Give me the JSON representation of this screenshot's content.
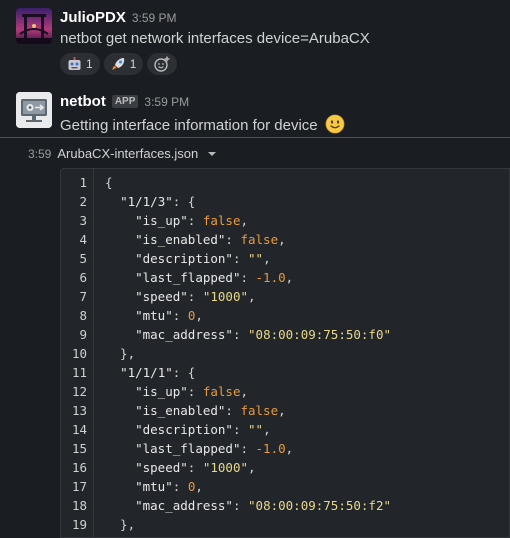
{
  "message1": {
    "author": "JulioPDX",
    "time": "3:59 PM",
    "text": "netbot get network interfaces device=ArubaCX",
    "reactions": [
      {
        "emoji": "robot-face",
        "count": "1"
      },
      {
        "emoji": "rocket",
        "count": "1"
      }
    ]
  },
  "message2": {
    "author": "netbot",
    "badge": "APP",
    "time": "3:59 PM",
    "text": "Getting interface information for device",
    "emoji": "slightly-smiling-face"
  },
  "file": {
    "time": "3:59",
    "name": "ArubaCX-interfaces.json"
  },
  "code_lines": [
    {
      "n": "1",
      "parts": [
        {
          "t": "{",
          "c": "p"
        }
      ]
    },
    {
      "n": "2",
      "parts": [
        {
          "t": "  ",
          "c": "p"
        },
        {
          "t": "\"1/1/3\"",
          "c": "k"
        },
        {
          "t": ": {",
          "c": "p"
        }
      ]
    },
    {
      "n": "3",
      "parts": [
        {
          "t": "    ",
          "c": "p"
        },
        {
          "t": "\"is_up\"",
          "c": "k"
        },
        {
          "t": ": ",
          "c": "p"
        },
        {
          "t": "false",
          "c": "b"
        },
        {
          "t": ",",
          "c": "p"
        }
      ]
    },
    {
      "n": "4",
      "parts": [
        {
          "t": "    ",
          "c": "p"
        },
        {
          "t": "\"is_enabled\"",
          "c": "k"
        },
        {
          "t": ": ",
          "c": "p"
        },
        {
          "t": "false",
          "c": "b"
        },
        {
          "t": ",",
          "c": "p"
        }
      ]
    },
    {
      "n": "5",
      "parts": [
        {
          "t": "    ",
          "c": "p"
        },
        {
          "t": "\"description\"",
          "c": "k"
        },
        {
          "t": ": ",
          "c": "p"
        },
        {
          "t": "\"\"",
          "c": "s"
        },
        {
          "t": ",",
          "c": "p"
        }
      ]
    },
    {
      "n": "6",
      "parts": [
        {
          "t": "    ",
          "c": "p"
        },
        {
          "t": "\"last_flapped\"",
          "c": "k"
        },
        {
          "t": ": ",
          "c": "p"
        },
        {
          "t": "-1.0",
          "c": "n"
        },
        {
          "t": ",",
          "c": "p"
        }
      ]
    },
    {
      "n": "7",
      "parts": [
        {
          "t": "    ",
          "c": "p"
        },
        {
          "t": "\"speed\"",
          "c": "k"
        },
        {
          "t": ": ",
          "c": "p"
        },
        {
          "t": "\"1000\"",
          "c": "s"
        },
        {
          "t": ",",
          "c": "p"
        }
      ]
    },
    {
      "n": "8",
      "parts": [
        {
          "t": "    ",
          "c": "p"
        },
        {
          "t": "\"mtu\"",
          "c": "k"
        },
        {
          "t": ": ",
          "c": "p"
        },
        {
          "t": "0",
          "c": "n"
        },
        {
          "t": ",",
          "c": "p"
        }
      ]
    },
    {
      "n": "9",
      "parts": [
        {
          "t": "    ",
          "c": "p"
        },
        {
          "t": "\"mac_address\"",
          "c": "k"
        },
        {
          "t": ": ",
          "c": "p"
        },
        {
          "t": "\"08:00:09:75:50:f0\"",
          "c": "s"
        }
      ]
    },
    {
      "n": "10",
      "parts": [
        {
          "t": "  },",
          "c": "p"
        }
      ]
    },
    {
      "n": "11",
      "parts": [
        {
          "t": "  ",
          "c": "p"
        },
        {
          "t": "\"1/1/1\"",
          "c": "k"
        },
        {
          "t": ": {",
          "c": "p"
        }
      ]
    },
    {
      "n": "12",
      "parts": [
        {
          "t": "    ",
          "c": "p"
        },
        {
          "t": "\"is_up\"",
          "c": "k"
        },
        {
          "t": ": ",
          "c": "p"
        },
        {
          "t": "false",
          "c": "b"
        },
        {
          "t": ",",
          "c": "p"
        }
      ]
    },
    {
      "n": "13",
      "parts": [
        {
          "t": "    ",
          "c": "p"
        },
        {
          "t": "\"is_enabled\"",
          "c": "k"
        },
        {
          "t": ": ",
          "c": "p"
        },
        {
          "t": "false",
          "c": "b"
        },
        {
          "t": ",",
          "c": "p"
        }
      ]
    },
    {
      "n": "14",
      "parts": [
        {
          "t": "    ",
          "c": "p"
        },
        {
          "t": "\"description\"",
          "c": "k"
        },
        {
          "t": ": ",
          "c": "p"
        },
        {
          "t": "\"\"",
          "c": "s"
        },
        {
          "t": ",",
          "c": "p"
        }
      ]
    },
    {
      "n": "15",
      "parts": [
        {
          "t": "    ",
          "c": "p"
        },
        {
          "t": "\"last_flapped\"",
          "c": "k"
        },
        {
          "t": ": ",
          "c": "p"
        },
        {
          "t": "-1.0",
          "c": "n"
        },
        {
          "t": ",",
          "c": "p"
        }
      ]
    },
    {
      "n": "16",
      "parts": [
        {
          "t": "    ",
          "c": "p"
        },
        {
          "t": "\"speed\"",
          "c": "k"
        },
        {
          "t": ": ",
          "c": "p"
        },
        {
          "t": "\"1000\"",
          "c": "s"
        },
        {
          "t": ",",
          "c": "p"
        }
      ]
    },
    {
      "n": "17",
      "parts": [
        {
          "t": "    ",
          "c": "p"
        },
        {
          "t": "\"mtu\"",
          "c": "k"
        },
        {
          "t": ": ",
          "c": "p"
        },
        {
          "t": "0",
          "c": "n"
        },
        {
          "t": ",",
          "c": "p"
        }
      ]
    },
    {
      "n": "18",
      "parts": [
        {
          "t": "    ",
          "c": "p"
        },
        {
          "t": "\"mac_address\"",
          "c": "k"
        },
        {
          "t": ": ",
          "c": "p"
        },
        {
          "t": "\"08:00:09:75:50:f2\"",
          "c": "s"
        }
      ]
    },
    {
      "n": "19",
      "parts": [
        {
          "t": "  },",
          "c": "p"
        }
      ]
    }
  ]
}
